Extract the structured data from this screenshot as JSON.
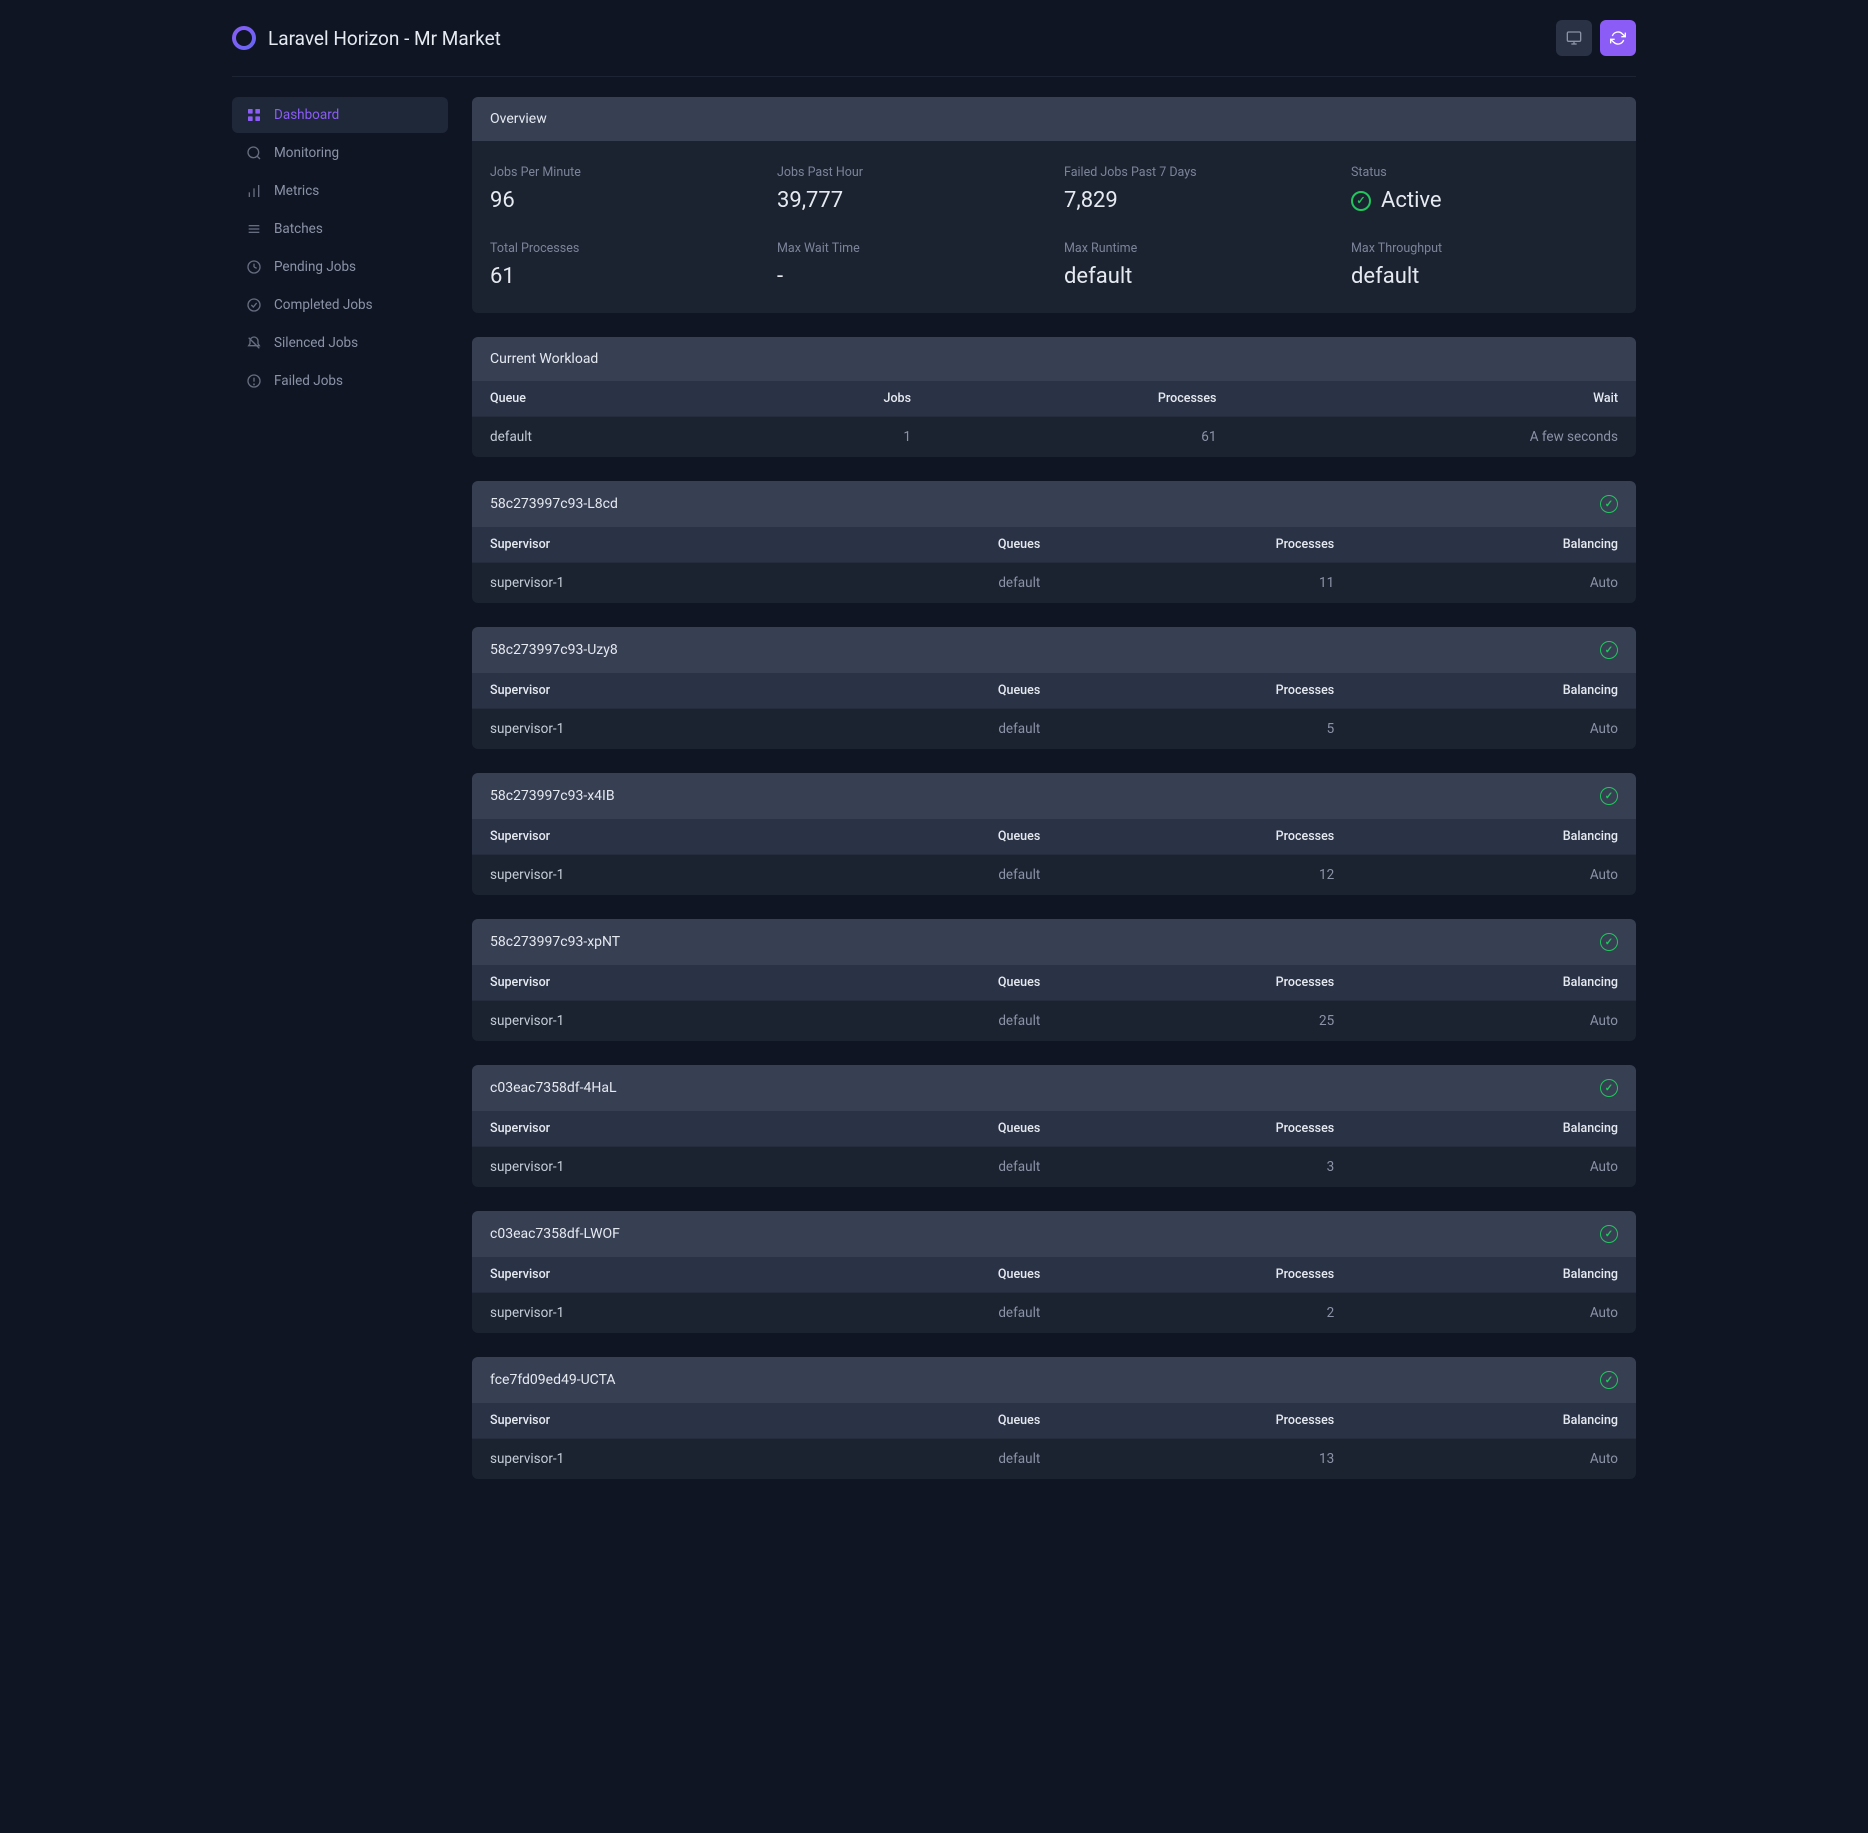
{
  "header": {
    "title": "Laravel Horizon - Mr Market"
  },
  "sidebar": {
    "items": [
      {
        "label": "Dashboard",
        "active": true
      },
      {
        "label": "Monitoring",
        "active": false
      },
      {
        "label": "Metrics",
        "active": false
      },
      {
        "label": "Batches",
        "active": false
      },
      {
        "label": "Pending Jobs",
        "active": false
      },
      {
        "label": "Completed Jobs",
        "active": false
      },
      {
        "label": "Silenced Jobs",
        "active": false
      },
      {
        "label": "Failed Jobs",
        "active": false
      }
    ]
  },
  "overview": {
    "title": "Overview",
    "stats": [
      {
        "label": "Jobs Per Minute",
        "value": "96"
      },
      {
        "label": "Jobs Past Hour",
        "value": "39,777"
      },
      {
        "label": "Failed Jobs Past 7 Days",
        "value": "7,829"
      },
      {
        "label": "Status",
        "value": "Active",
        "status": true
      },
      {
        "label": "Total Processes",
        "value": "61"
      },
      {
        "label": "Max Wait Time",
        "value": "-"
      },
      {
        "label": "Max Runtime",
        "value": "default"
      },
      {
        "label": "Max Throughput",
        "value": "default"
      }
    ]
  },
  "workload": {
    "title": "Current Workload",
    "columns": [
      "Queue",
      "Jobs",
      "Processes",
      "Wait"
    ],
    "rows": [
      {
        "queue": "default",
        "jobs": "1",
        "processes": "61",
        "wait": "A few seconds"
      }
    ]
  },
  "supervisor_columns": [
    "Supervisor",
    "Queues",
    "Processes",
    "Balancing"
  ],
  "workers": [
    {
      "name": "58c273997c93-L8cd",
      "rows": [
        {
          "supervisor": "supervisor-1",
          "queues": "default",
          "processes": "11",
          "balancing": "Auto"
        }
      ]
    },
    {
      "name": "58c273997c93-Uzy8",
      "rows": [
        {
          "supervisor": "supervisor-1",
          "queues": "default",
          "processes": "5",
          "balancing": "Auto"
        }
      ]
    },
    {
      "name": "58c273997c93-x4IB",
      "rows": [
        {
          "supervisor": "supervisor-1",
          "queues": "default",
          "processes": "12",
          "balancing": "Auto"
        }
      ]
    },
    {
      "name": "58c273997c93-xpNT",
      "rows": [
        {
          "supervisor": "supervisor-1",
          "queues": "default",
          "processes": "25",
          "balancing": "Auto"
        }
      ]
    },
    {
      "name": "c03eac7358df-4HaL",
      "rows": [
        {
          "supervisor": "supervisor-1",
          "queues": "default",
          "processes": "3",
          "balancing": "Auto"
        }
      ]
    },
    {
      "name": "c03eac7358df-LWOF",
      "rows": [
        {
          "supervisor": "supervisor-1",
          "queues": "default",
          "processes": "2",
          "balancing": "Auto"
        }
      ]
    },
    {
      "name": "fce7fd09ed49-UCTA",
      "rows": [
        {
          "supervisor": "supervisor-1",
          "queues": "default",
          "processes": "13",
          "balancing": "Auto"
        }
      ]
    }
  ]
}
